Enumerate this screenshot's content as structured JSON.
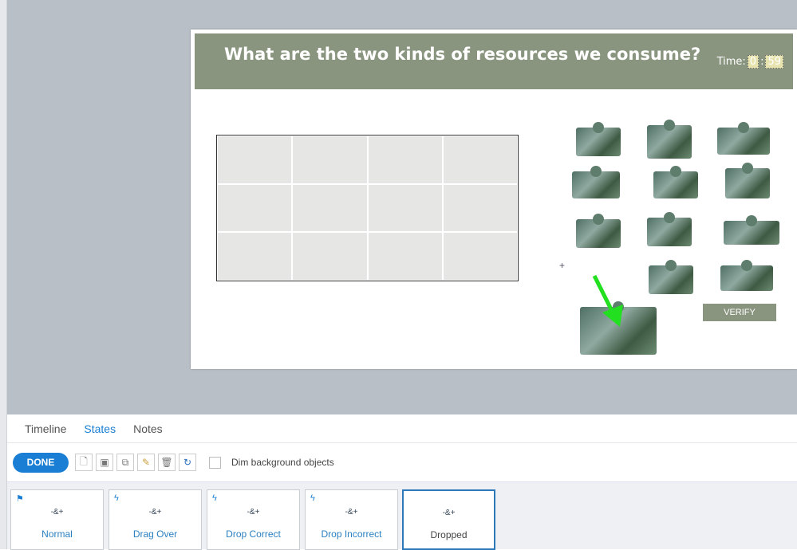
{
  "slide": {
    "title": "What are the two kinds of resources we consume?",
    "timer_label": "Time:",
    "timer_minutes": "0",
    "timer_sep": ":",
    "timer_seconds": "59",
    "verify_label": "VERIFY",
    "plus": "+"
  },
  "tabs": [
    {
      "label": "Timeline"
    },
    {
      "label": "States",
      "active": true
    },
    {
      "label": "Notes"
    }
  ],
  "toolbar": {
    "done_label": "DONE",
    "icons": [
      "new-state-icon",
      "image-icon",
      "duplicate-icon",
      "edit-icon",
      "delete-icon",
      "reset-icon"
    ],
    "dim_label": "Dim background objects",
    "dim_checked": false
  },
  "states": [
    {
      "label": "Normal",
      "icon": "flag-icon"
    },
    {
      "label": "Drag Over",
      "icon": "lightning-icon"
    },
    {
      "label": "Drop Correct",
      "icon": "lightning-icon"
    },
    {
      "label": "Drop Incorrect",
      "icon": "lightning-icon"
    },
    {
      "label": "Dropped",
      "icon": "",
      "selected": true
    }
  ],
  "colors": {
    "accent": "#1a7fd4",
    "header": "#8a9580",
    "arrow": "#22e01f"
  }
}
